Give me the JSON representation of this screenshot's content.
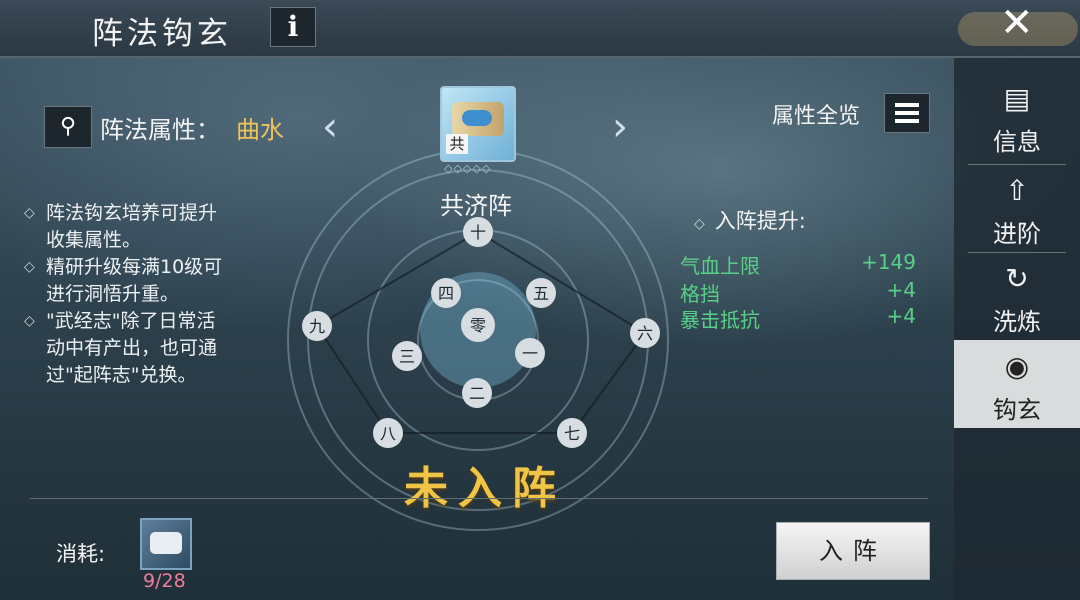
{
  "header": {
    "title": "阵法钩玄",
    "info_label": "i",
    "close_label": "✕"
  },
  "formation": {
    "attr_label": "阵法属性：",
    "attr_value": "曲水",
    "search_icon": "search-icon",
    "prev_arrow": "‹",
    "next_arrow": "›",
    "icon_tag": "共",
    "stars": "◇◇◇◇◇",
    "name": "共济阵",
    "overview_label": "属性全览",
    "status": "未入阵",
    "nodes": [
      "十",
      "九",
      "四",
      "五",
      "零",
      "一",
      "三",
      "二",
      "六",
      "八",
      "七"
    ]
  },
  "notes": [
    "阵法钩玄培养可提升收集属性。",
    "精研升级每满10级可进行洞悟升重。",
    "\"武经志\"除了日常活动中有产出，也可通过\"起阵志\"兑换。"
  ],
  "bonus": {
    "title": "入阵提升:",
    "rows": [
      {
        "name": "气血上限",
        "value": "+149"
      },
      {
        "name": "格挡",
        "value": "+4"
      },
      {
        "name": "暴击抵抗",
        "value": "+4"
      }
    ]
  },
  "cost": {
    "label": "消耗:",
    "count": "9/28"
  },
  "enter_button": "入阵",
  "sidebar": {
    "items": [
      {
        "label": "信息",
        "icon": "scroll-icon"
      },
      {
        "label": "进阶",
        "icon": "upgrade-arrows-icon"
      },
      {
        "label": "洗炼",
        "icon": "refine-cycle-icon"
      },
      {
        "label": "钩玄",
        "icon": "spiral-icon"
      }
    ],
    "active": 3
  },
  "colors": {
    "accent_gold": "#f1c35b",
    "bonus_green": "#58d087",
    "cost_pink": "#f07e9b"
  }
}
